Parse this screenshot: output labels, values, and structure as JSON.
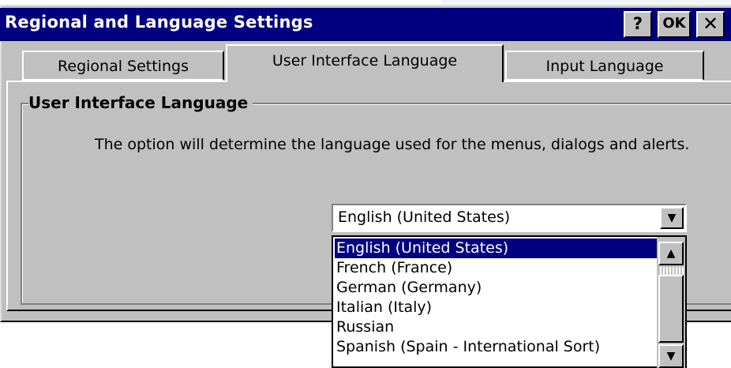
{
  "window": {
    "title": "Regional and Language Settings",
    "help_label": "?",
    "ok_label": "OK",
    "close_label": "✕"
  },
  "tabs": [
    {
      "label": "Regional Settings",
      "active": false
    },
    {
      "label": "User Interface Language",
      "active": true
    },
    {
      "label": "Input Language",
      "active": false
    }
  ],
  "group": {
    "legend": "User Interface Language",
    "description": "The option will determine the language used for the menus, dialogs and alerts."
  },
  "language_combo": {
    "selected": "English (United States)",
    "arrow_icon": "▼",
    "options": [
      "English (United States)",
      "French (France)",
      "German (Germany)",
      "Italian (Italy)",
      "Russian",
      "Spanish (Spain - International Sort)"
    ],
    "highlighted_index": 0
  },
  "scrollbar": {
    "up_icon": "▲",
    "down_icon": "▼"
  },
  "colors": {
    "titlebar": "#000080",
    "face": "#c0c0c0",
    "selection": "#000080"
  }
}
